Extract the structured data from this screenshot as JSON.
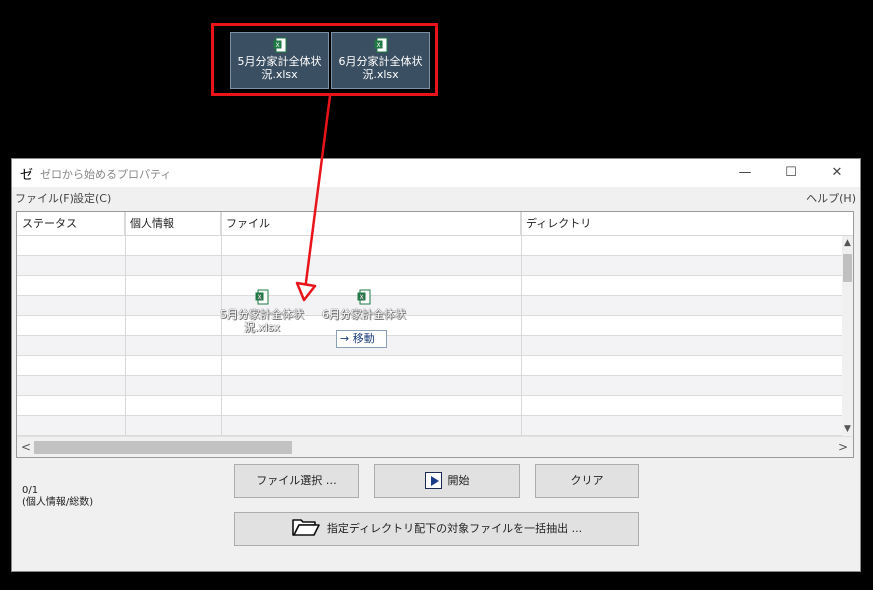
{
  "drag_files": [
    {
      "name_line1": "5月分家計全体状",
      "name_line2": "況.xlsx"
    },
    {
      "name_line1": "6月分家計全体状",
      "name_line2": "況.xlsx"
    }
  ],
  "window": {
    "icon_glyph": "ゼ",
    "title": "ゼロから始めるプロパティ",
    "min_glyph": "—",
    "max_glyph": "☐",
    "close_glyph": "✕"
  },
  "menu": {
    "file": "ファイル(F)",
    "settings": "設定(C)",
    "help": "ヘルプ(H)"
  },
  "grid": {
    "columns": [
      "ステータス",
      "個人情報",
      "ファイル",
      "ディレクトリ"
    ],
    "row_count": 10
  },
  "drop_preview": {
    "tooltip": "→ 移動"
  },
  "status": {
    "count": "0/1",
    "count_label": "(個人情報/総数)"
  },
  "buttons": {
    "select_file": "ファイル選択 …",
    "start": "開始",
    "clear": "クリア",
    "extract": "指定ディレクトリ配下の対象ファイルを一括抽出 ..."
  },
  "colors": {
    "highlight_border": "#e8141a",
    "excel_green": "#1e7a43"
  }
}
